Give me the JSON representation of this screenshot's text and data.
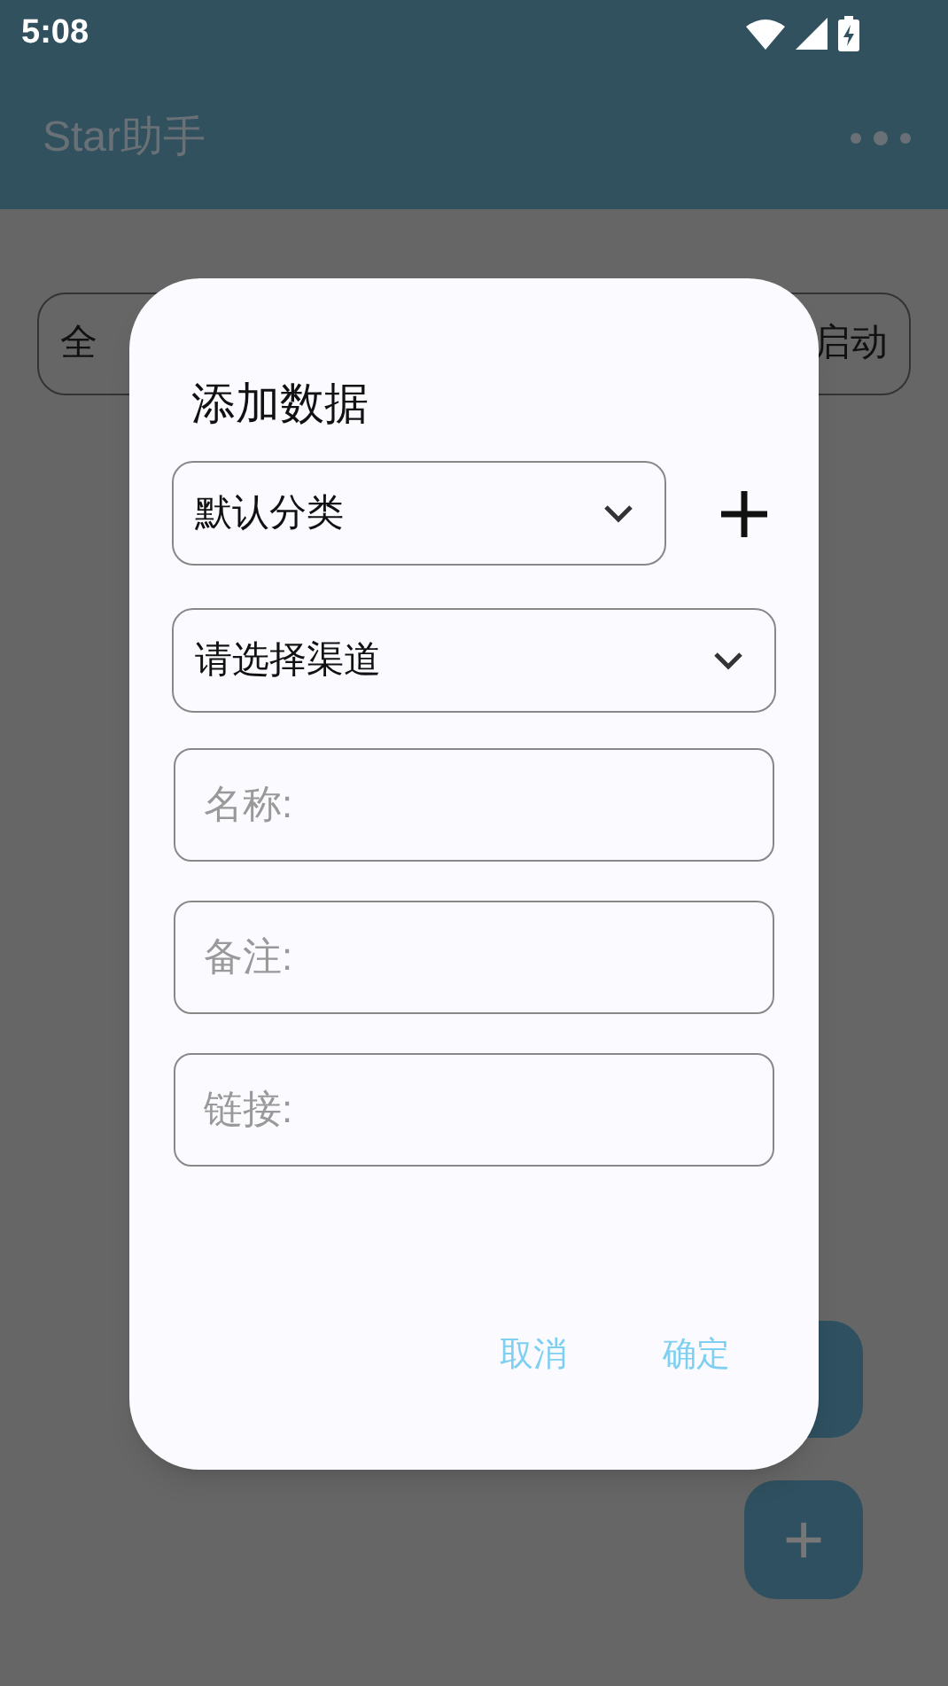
{
  "status_bar": {
    "time": "5:08"
  },
  "app_bar": {
    "title": "Star助手"
  },
  "filter_chips": [
    {
      "label": "全"
    },
    {
      "label": "启动"
    }
  ],
  "dialog": {
    "title": "添加数据",
    "category_select": {
      "value": "默认分类"
    },
    "channel_select": {
      "value": "请选择渠道"
    },
    "fields": [
      {
        "placeholder": "名称:"
      },
      {
        "placeholder": "备注:"
      },
      {
        "placeholder": "链接:"
      }
    ],
    "buttons": [
      "取消",
      "确定"
    ]
  },
  "fab_add": {
    "label": "+"
  }
}
